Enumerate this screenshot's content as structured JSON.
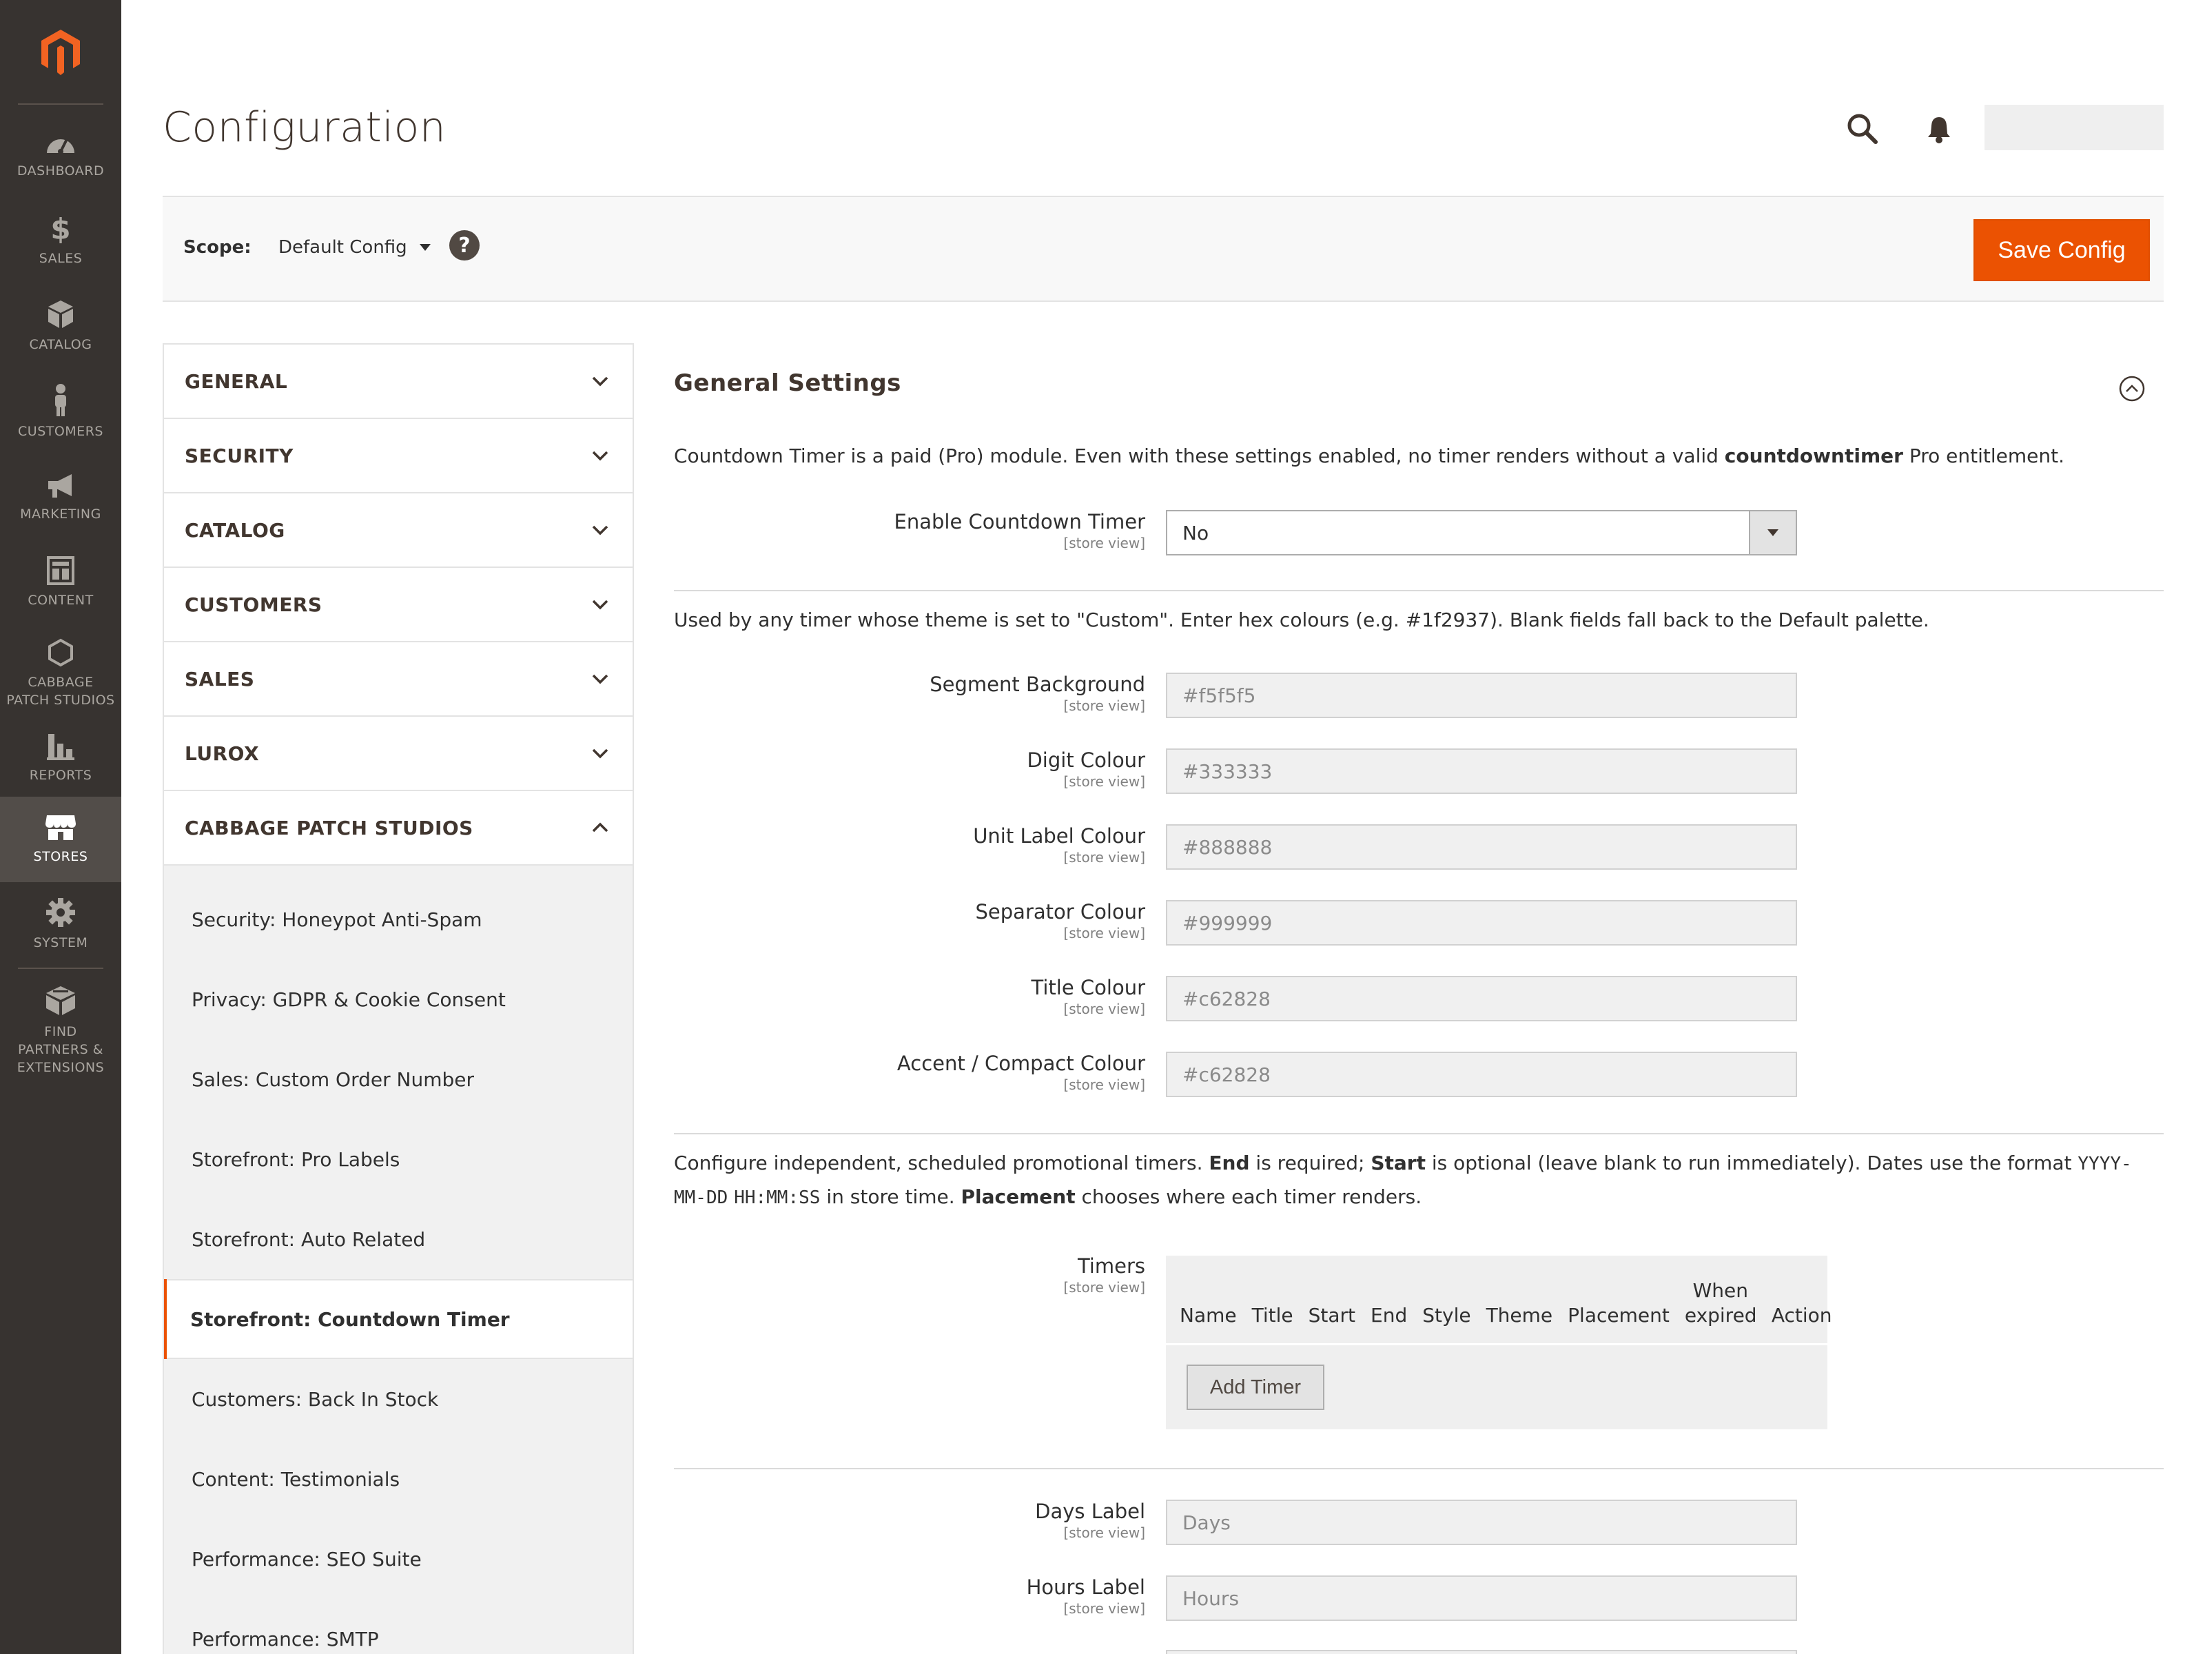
{
  "menu": {
    "items": [
      {
        "label": "DASHBOARD",
        "icon": "dashboard-icon"
      },
      {
        "label": "SALES",
        "icon": "dollar-icon"
      },
      {
        "label": "CATALOG",
        "icon": "cube-icon"
      },
      {
        "label": "CUSTOMERS",
        "icon": "person-icon"
      },
      {
        "label": "MARKETING",
        "icon": "megaphone-icon"
      },
      {
        "label": "CONTENT",
        "icon": "layout-icon"
      },
      {
        "label_1": "CABBAGE",
        "label_2": "PATCH STUDIOS",
        "icon": "hexagon-icon"
      },
      {
        "label": "REPORTS",
        "icon": "bar-chart-icon"
      },
      {
        "label": "STORES",
        "icon": "store-icon",
        "active": true
      },
      {
        "label": "SYSTEM",
        "icon": "gear-icon"
      },
      {
        "label_1": "FIND",
        "label_2": "PARTNERS &",
        "label_3": "EXTENSIONS",
        "icon": "boxes-icon"
      }
    ]
  },
  "header": {
    "title": "Configuration"
  },
  "scope": {
    "label": "Scope:",
    "value": "Default Config",
    "help": "?"
  },
  "actions": {
    "save_label": "Save Config"
  },
  "tabs": {
    "groups": [
      {
        "label": "GENERAL"
      },
      {
        "label": "SECURITY"
      },
      {
        "label": "CATALOG"
      },
      {
        "label": "CUSTOMERS"
      },
      {
        "label": "SALES"
      },
      {
        "label": "LUROX"
      },
      {
        "label": "CABBAGE PATCH STUDIOS",
        "expanded": true
      }
    ],
    "items": [
      {
        "label": "Security: Honeypot Anti-Spam"
      },
      {
        "label": "Privacy: GDPR & Cookie Consent"
      },
      {
        "label": "Sales: Custom Order Number"
      },
      {
        "label": "Storefront: Pro Labels"
      },
      {
        "label": "Storefront: Auto Related"
      },
      {
        "label": "Storefront: Countdown Timer",
        "active": true
      },
      {
        "label": "Customers: Back In Stock"
      },
      {
        "label": "Content: Testimonials"
      },
      {
        "label": "Performance: SEO Suite"
      },
      {
        "label": "Performance: SMTP"
      }
    ]
  },
  "section": {
    "title": "General Settings",
    "intro_1_pre": "Countdown Timer is a paid (Pro) module. Even with these settings enabled, no timer renders without a valid ",
    "intro_1_bold": "countdowntimer",
    "intro_1_post": " Pro entitlement.",
    "enable": {
      "label": "Enable Countdown Timer",
      "scope": "[store view]",
      "value": "No"
    },
    "intro_2": "Used by any timer whose theme is set to \"Custom\". Enter hex colours (e.g. #1f2937). Blank fields fall back to the Default palette.",
    "colors": [
      {
        "label": "Segment Background",
        "scope": "[store view]",
        "placeholder": "#f5f5f5"
      },
      {
        "label": "Digit Colour",
        "scope": "[store view]",
        "placeholder": "#333333"
      },
      {
        "label": "Unit Label Colour",
        "scope": "[store view]",
        "placeholder": "#888888"
      },
      {
        "label": "Separator Colour",
        "scope": "[store view]",
        "placeholder": "#999999"
      },
      {
        "label": "Title Colour",
        "scope": "[store view]",
        "placeholder": "#c62828"
      },
      {
        "label": "Accent / Compact Colour",
        "scope": "[store view]",
        "placeholder": "#c62828"
      }
    ],
    "intro_3": {
      "t1": "Configure independent, scheduled promotional timers. ",
      "b1": "End",
      "t2": " is required; ",
      "b2": "Start",
      "t3": " is optional (leave blank to run immediately). Dates use the format ",
      "c1": "YYYY-MM-DD",
      "c2": "HH:MM:SS",
      "t4": " in store time. ",
      "b3": "Placement",
      "t5": " chooses where each timer renders."
    },
    "timers": {
      "label": "Timers",
      "scope": "[store view]",
      "columns": [
        "Name",
        "Title",
        "Start",
        "End",
        "Style",
        "Theme",
        "Placement",
        "When expired",
        "Action"
      ],
      "add_label": "Add Timer"
    },
    "labels": [
      {
        "label": "Days Label",
        "scope": "[store view]",
        "placeholder": "Days"
      },
      {
        "label": "Hours Label",
        "scope": "[store view]",
        "placeholder": "Hours"
      }
    ]
  },
  "colors": {
    "accent": "#eb5202",
    "menu_bg": "#373330",
    "menu_active": "#524d49"
  }
}
